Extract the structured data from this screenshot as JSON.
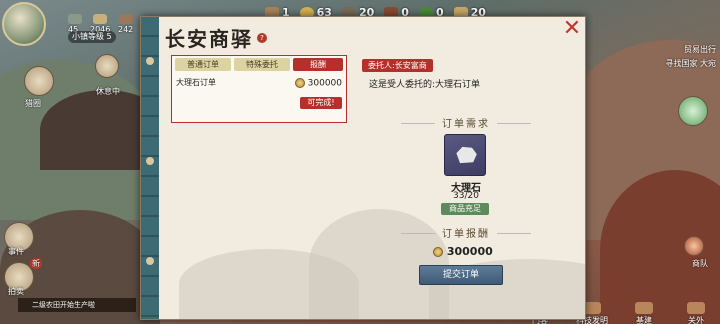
{
  "hud": {
    "stats": [
      {
        "value": "45",
        "icon": "tool-icon"
      },
      {
        "value": "2046",
        "icon": "people-icon"
      },
      {
        "value": "242",
        "icon": "house-icon"
      }
    ],
    "town_level": "小镇等级 5",
    "resources": [
      {
        "icon": "wood-icon",
        "value": "1"
      },
      {
        "icon": "gold-icon",
        "value": "63"
      },
      {
        "icon": "bird-icon",
        "value": "20"
      },
      {
        "icon": "meat-icon",
        "value": "0"
      },
      {
        "icon": "cabbage-icon",
        "value": "0"
      },
      {
        "icon": "grain-icon",
        "value": "20"
      }
    ]
  },
  "left_side": {
    "hunt_label": "猎圈",
    "rest_label": "休息中",
    "btn1_label": "事件",
    "btn2_label": "拍卖",
    "badge": "新",
    "notice": "二级农田开始生产啦"
  },
  "right_side": {
    "trade_out": "贸易出行",
    "find_country": "寻找国家 大宛",
    "merchant": "商队"
  },
  "bottom_nav": [
    {
      "label": "门客",
      "icon": "guest-icon"
    },
    {
      "label": "科技发明",
      "icon": "tech-icon"
    },
    {
      "label": "基建",
      "icon": "build-icon"
    },
    {
      "label": "关外",
      "icon": "frontier-icon"
    }
  ],
  "dialog": {
    "title": "长安商驿",
    "help": "?",
    "tabs": {
      "normal": "普通订单",
      "special": "特殊委托",
      "reward": "报酬"
    },
    "order": {
      "name": "大理石订单",
      "reward": "300000",
      "status": "可完成!"
    },
    "client": "委托人:长安富商",
    "description": "这是受人委托的:大理石订单",
    "requirement_head": "订单需求",
    "item": {
      "name": "大理石",
      "count": "33/20",
      "status": "商品充足"
    },
    "reward_head": "订单报酬",
    "total_reward": "300000",
    "submit": "提交订单"
  },
  "colors": {
    "accent_red": "#b5302a",
    "spine": "#3e6a74",
    "submit_blue": "#4f6e8a",
    "sufficient_green": "#5c8a5a"
  }
}
